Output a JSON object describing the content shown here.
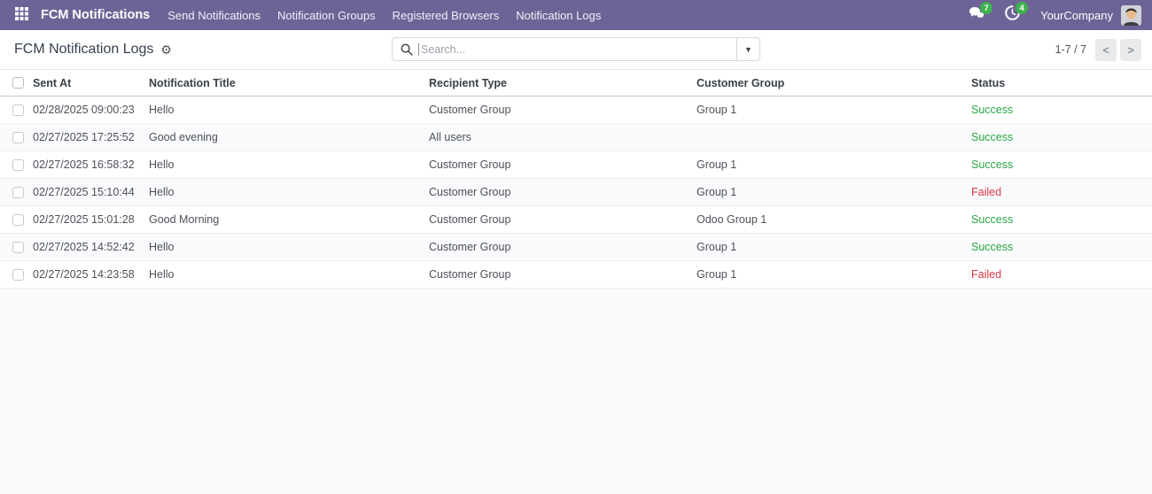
{
  "topbar": {
    "brand": "FCM Notifications",
    "menus": [
      "Send Notifications",
      "Notification Groups",
      "Registered Browsers",
      "Notification Logs"
    ],
    "systray": {
      "messages_count": "7",
      "activities_count": "4",
      "company": "YourCompany"
    }
  },
  "control": {
    "title": "FCM Notification Logs",
    "search_placeholder": "Search...",
    "pager_range": "1-7 / 7",
    "prev_label": "<",
    "next_label": ">"
  },
  "table": {
    "columns": [
      "Sent At",
      "Notification Title",
      "Recipient Type",
      "Customer Group",
      "Status"
    ],
    "rows": [
      {
        "sent_at": "02/28/2025 09:00:23",
        "title": "Hello",
        "recipient": "Customer Group",
        "group": "Group 1",
        "status": "Success"
      },
      {
        "sent_at": "02/27/2025 17:25:52",
        "title": "Good evening",
        "recipient": "All users",
        "group": "",
        "status": "Success"
      },
      {
        "sent_at": "02/27/2025 16:58:32",
        "title": "Hello",
        "recipient": "Customer Group",
        "group": "Group 1",
        "status": "Success"
      },
      {
        "sent_at": "02/27/2025 15:10:44",
        "title": "Hello",
        "recipient": "Customer Group",
        "group": "Group 1",
        "status": "Failed"
      },
      {
        "sent_at": "02/27/2025 15:01:28",
        "title": "Good Morning",
        "recipient": "Customer Group",
        "group": "Odoo Group 1",
        "status": "Success"
      },
      {
        "sent_at": "02/27/2025 14:52:42",
        "title": "Hello",
        "recipient": "Customer Group",
        "group": "Group 1",
        "status": "Success"
      },
      {
        "sent_at": "02/27/2025 14:23:58",
        "title": "Hello",
        "recipient": "Customer Group",
        "group": "Group 1",
        "status": "Failed"
      }
    ]
  },
  "colors": {
    "topbar_bg": "#6e6396",
    "badge_green": "#3cb24e",
    "success": "#28a745",
    "failed": "#dc3545"
  }
}
